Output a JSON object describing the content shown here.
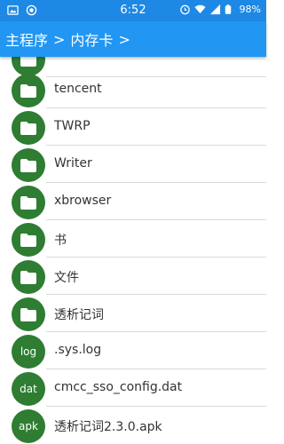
{
  "status_bar": {
    "time": "6:52",
    "battery": "98%",
    "icons": [
      "photo-icon",
      "record-icon",
      "alarm-icon",
      "wifi-icon",
      "signal-icon",
      "battery-icon"
    ]
  },
  "app_bar": {
    "breadcrumb": [
      {
        "label": "主程序"
      },
      {
        "label": "内存卡"
      }
    ],
    "separator": ">"
  },
  "files": [
    {
      "name": "",
      "kind": "folder",
      "icon": "folder-icon"
    },
    {
      "name": "tencent",
      "kind": "folder",
      "icon": "folder-icon"
    },
    {
      "name": "TWRP",
      "kind": "folder",
      "icon": "folder-icon"
    },
    {
      "name": "Writer",
      "kind": "folder",
      "icon": "folder-icon"
    },
    {
      "name": "xbrowser",
      "kind": "folder",
      "icon": "folder-icon"
    },
    {
      "name": "书",
      "kind": "folder",
      "icon": "folder-icon"
    },
    {
      "name": "文件",
      "kind": "folder",
      "icon": "folder-icon"
    },
    {
      "name": "透析记词",
      "kind": "folder",
      "icon": "folder-icon"
    },
    {
      "name": ".sys.log",
      "kind": "file",
      "icon_text": "log"
    },
    {
      "name": "cmcc_sso_config.dat",
      "kind": "file",
      "icon_text": "dat"
    },
    {
      "name": "透析记词2.3.0.apk",
      "kind": "file",
      "icon_text": "apk"
    }
  ],
  "colors": {
    "status_bar": "#1e88e5",
    "app_bar": "#2196f3",
    "icon_circle": "#2e7d32",
    "divider": "#d9d9d9"
  }
}
